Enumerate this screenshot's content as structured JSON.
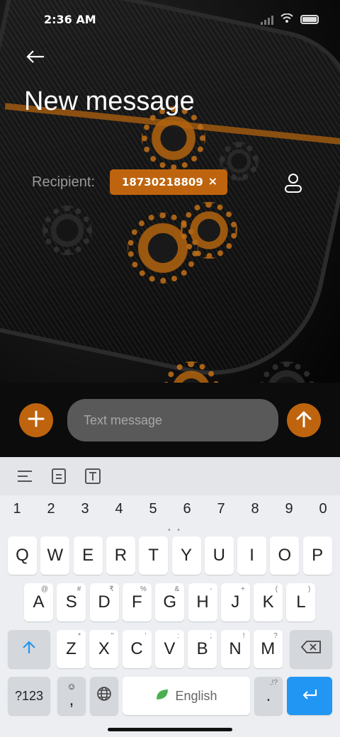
{
  "status_bar": {
    "time": "2:36 AM",
    "icons": [
      "signal-icon",
      "wifi-icon",
      "battery-icon"
    ]
  },
  "header": {
    "back_icon": "arrow-left-icon",
    "title": "New message"
  },
  "recipient": {
    "label": "Recipient:",
    "chip_value": "18730218809",
    "chip_remove": "×",
    "contact_icon": "person-icon"
  },
  "compose": {
    "placeholder": "Text message",
    "attach_icon": "plus-icon",
    "send_icon": "arrow-up-icon"
  },
  "colors": {
    "accent": "#bf640e",
    "keyboard_bg": "#eceef1",
    "enter_key": "#2196f3"
  },
  "keyboard": {
    "toolbar_icons": [
      "align-icon",
      "clipboard-icon",
      "text-icon"
    ],
    "numbers": [
      "1",
      "2",
      "3",
      "4",
      "5",
      "6",
      "7",
      "8",
      "9",
      "0"
    ],
    "row1": [
      "Q",
      "W",
      "E",
      "R",
      "T",
      "Y",
      "U",
      "I",
      "O",
      "P"
    ],
    "row2": [
      {
        "key": "A",
        "hint": "@"
      },
      {
        "key": "S",
        "hint": "#"
      },
      {
        "key": "D",
        "hint": "₹"
      },
      {
        "key": "F",
        "hint": "%"
      },
      {
        "key": "G",
        "hint": "&"
      },
      {
        "key": "H",
        "hint": "-"
      },
      {
        "key": "J",
        "hint": "+"
      },
      {
        "key": "K",
        "hint": "("
      },
      {
        "key": "L",
        "hint": ")"
      }
    ],
    "row3": [
      {
        "key": "Z",
        "hint": "*"
      },
      {
        "key": "X",
        "hint": "\""
      },
      {
        "key": "C",
        "hint": "'"
      },
      {
        "key": "V",
        "hint": ":"
      },
      {
        "key": "B",
        "hint": ";"
      },
      {
        "key": "N",
        "hint": "!"
      },
      {
        "key": "M",
        "hint": "?"
      }
    ],
    "symbols_label": "?123",
    "comma_label": ",",
    "space_label": "English",
    "period_label": ".",
    "period_hint": ",!?"
  }
}
